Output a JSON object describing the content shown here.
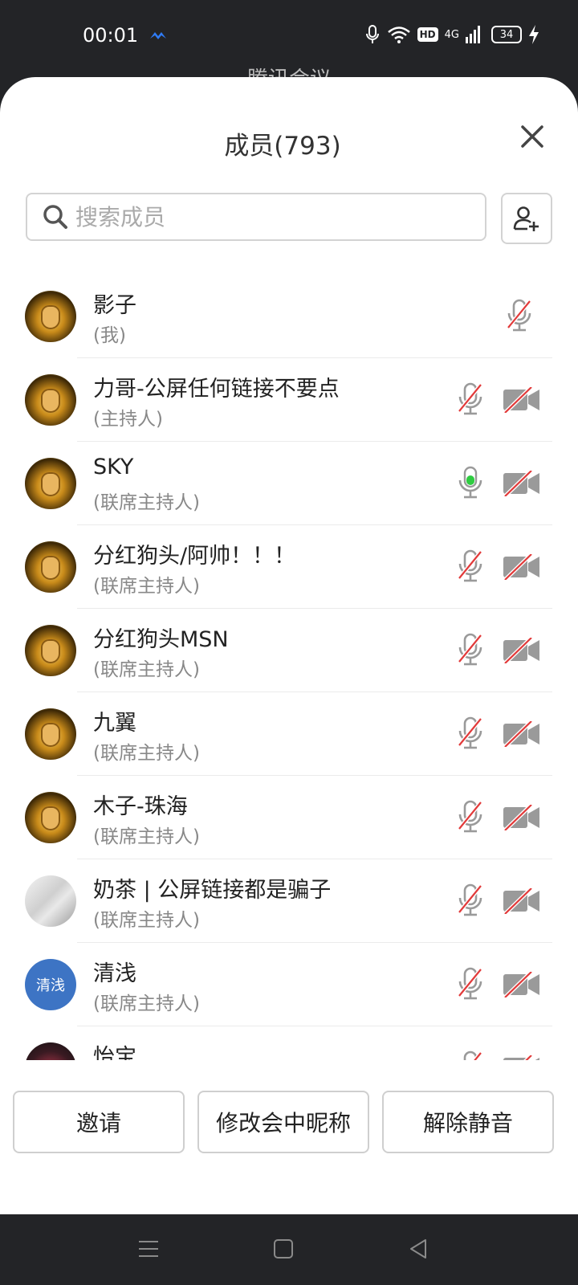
{
  "status_bar": {
    "time": "00:01",
    "network": "4G",
    "hd": "HD",
    "battery": "34"
  },
  "behind_title": "腾讯会议",
  "panel": {
    "title": "成员(793)",
    "search_placeholder": "搜索成员"
  },
  "members": [
    {
      "name": "影子",
      "role": "(我)",
      "avatar": "gold",
      "mic": "muted",
      "cam": "none"
    },
    {
      "name": "力哥-公屏任何链接不要点",
      "role": "(主持人)",
      "avatar": "gold",
      "mic": "muted",
      "cam": "off"
    },
    {
      "name": "SKY",
      "role": "(联席主持人)",
      "avatar": "gold",
      "mic": "active",
      "cam": "off"
    },
    {
      "name": "分红狗头/阿帅！！！",
      "role": "(联席主持人)",
      "avatar": "gold",
      "mic": "muted",
      "cam": "off"
    },
    {
      "name": "分红狗头MSN",
      "role": "(联席主持人)",
      "avatar": "gold",
      "mic": "muted",
      "cam": "off"
    },
    {
      "name": "九翼",
      "role": "(联席主持人)",
      "avatar": "gold",
      "mic": "muted",
      "cam": "off"
    },
    {
      "name": "木子-珠海",
      "role": "(联席主持人)",
      "avatar": "gold",
      "mic": "muted",
      "cam": "off"
    },
    {
      "name": "奶茶 | 公屏链接都是骗子",
      "role": "(联席主持人)",
      "avatar": "photo",
      "mic": "muted",
      "cam": "off"
    },
    {
      "name": "清浅",
      "role": "(联席主持人)",
      "avatar": "text",
      "avatar_text": "清浅",
      "mic": "muted",
      "cam": "off"
    },
    {
      "name": "怡宝",
      "role": "",
      "avatar": "dark",
      "mic": "muted",
      "cam": "off"
    }
  ],
  "buttons": {
    "invite": "邀请",
    "rename": "修改会中昵称",
    "unmute": "解除静音"
  },
  "colors": {
    "mic_active": "#2ecc40",
    "mute_slash": "#e23a3a",
    "icon_gray": "#9a9a9a",
    "avatar_blue": "#3d74c4"
  }
}
